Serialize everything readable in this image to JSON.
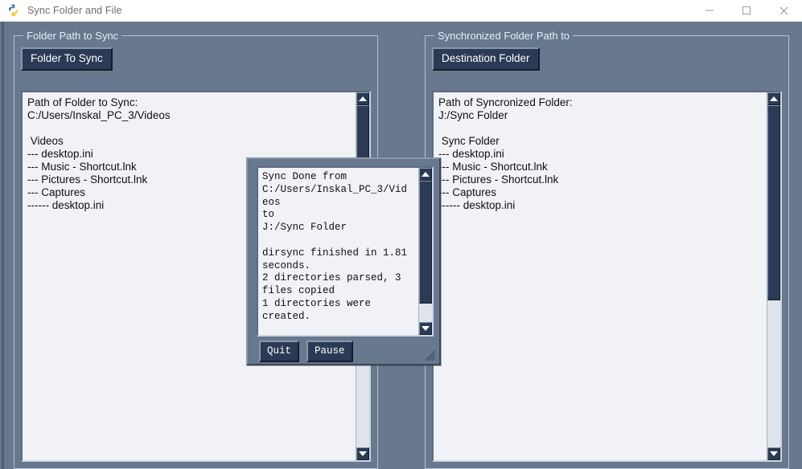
{
  "window": {
    "title": "Sync Folder and File",
    "icon": "python-logo-icon",
    "controls": {
      "minimize": "minimize-icon",
      "maximize": "maximize-icon",
      "close": "close-icon"
    }
  },
  "colors": {
    "window_background": "#67788f",
    "titlebar_background": "#ffffff",
    "titlebar_text": "#6c6c6c",
    "button_face": "#2b3a55",
    "button_text": "#ffffff",
    "text_area_background": "#f0f2f6",
    "text_area_text": "#101010",
    "group_border": "#b9c2cd",
    "scrollbar_track": "#dfe4ec",
    "scrollbar_thumb": "#2b3a55"
  },
  "left_panel": {
    "group_title": "Folder Path to Sync",
    "button_label": "Folder To Sync",
    "lines": [
      "Path of Folder to Sync:",
      "C:/Users/Inskal_PC_3/Videos",
      "",
      " Videos",
      "--- desktop.ini",
      "--- Music - Shortcut.lnk",
      "--- Pictures - Shortcut.lnk",
      "--- Captures",
      "------ desktop.ini"
    ],
    "scrollbar": {
      "up_arrow": "scroll-up-icon",
      "down_arrow": "scroll-down-icon",
      "thumb_top_pct": 0,
      "thumb_height_pct": 22
    }
  },
  "right_panel": {
    "group_title": "Synchronized Folder Path to",
    "button_label": "Destination Folder",
    "lines": [
      "Path of Syncronized Folder:",
      "J:/Sync Folder",
      "",
      " Sync Folder",
      "--- desktop.ini",
      "--- Music - Shortcut.lnk",
      "--- Pictures - Shortcut.lnk",
      "--- Captures",
      "------ desktop.ini"
    ],
    "scrollbar": {
      "up_arrow": "scroll-up-icon",
      "down_arrow": "scroll-down-icon",
      "thumb_top_pct": 0,
      "thumb_height_pct": 57
    }
  },
  "dialog": {
    "message": "Sync Done from\nC:/Users/Inskal_PC_3/Vid\neos\nto\nJ:/Sync Folder\n\ndirsync finished in 1.81\nseconds.\n2 directories parsed, 3\nfiles copied\n1 directories were\ncreated.",
    "quit_label": "Quit",
    "pause_label": "Pause",
    "scrollbar": {
      "up_arrow": "scroll-up-icon",
      "down_arrow": "scroll-down-icon",
      "thumb_top_pct": 0,
      "thumb_height_pct": 87
    },
    "resize_grip": "resize-grip-icon"
  }
}
